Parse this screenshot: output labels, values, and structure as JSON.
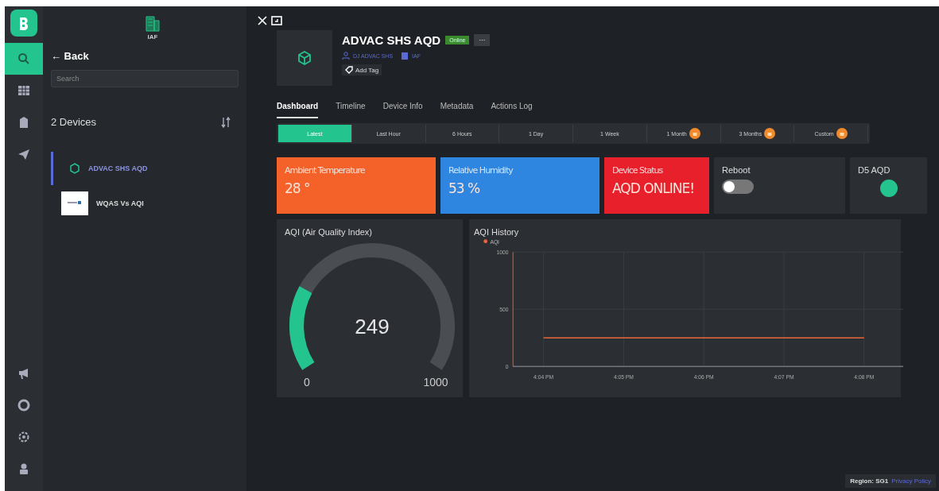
{
  "org": {
    "label": "IAF"
  },
  "nav": {
    "back": "← Back",
    "search": {
      "placeholder": "Search"
    },
    "count": "2 Devices"
  },
  "rail": [
    {
      "kind": "search",
      "selected": true
    },
    {
      "kind": "grid",
      "selected": false
    },
    {
      "kind": "building",
      "selected": false
    },
    {
      "kind": "send",
      "selected": false
    }
  ],
  "rail_bottom": [
    {
      "kind": "megaphone"
    },
    {
      "kind": "help"
    },
    {
      "kind": "settings"
    },
    {
      "kind": "user"
    }
  ],
  "devices": [
    {
      "name": "ADVAC SHS AQD",
      "selected": true,
      "kind": "cube"
    },
    {
      "name": "WQAS Vs AQI",
      "selected": false,
      "kind": "thumbnail"
    }
  ],
  "device": {
    "title": "ADVAC SHS AQD",
    "status": "Online",
    "more": "···",
    "owner": "DJ ADVAC SHS",
    "org": "IAF",
    "add_tag": "Add Tag"
  },
  "tabs": [
    {
      "label": "Dashboard",
      "selected": true
    },
    {
      "label": "Timeline",
      "selected": false
    },
    {
      "label": "Device Info",
      "selected": false
    },
    {
      "label": "Metadata",
      "selected": false
    },
    {
      "label": "Actions Log",
      "selected": false
    }
  ],
  "ranges": [
    {
      "label": "Latest",
      "selected": true,
      "locked": false
    },
    {
      "label": "Last Hour",
      "selected": false,
      "locked": false
    },
    {
      "label": "6 Hours",
      "selected": false,
      "locked": false
    },
    {
      "label": "1 Day",
      "selected": false,
      "locked": false
    },
    {
      "label": "1 Week",
      "selected": false,
      "locked": false
    },
    {
      "label": "1 Month",
      "selected": false,
      "locked": true
    },
    {
      "label": "3 Months",
      "selected": false,
      "locked": true
    },
    {
      "label": "Custom",
      "selected": false,
      "locked": true
    }
  ],
  "widgets": [
    {
      "kind": "value",
      "title": "Ambient Temperature",
      "value": "28 °",
      "color": "#f4622a"
    },
    {
      "kind": "value",
      "title": "Relative Humidity",
      "value": "53 %",
      "color": "#2f86e0"
    },
    {
      "kind": "value",
      "title": "Device Status",
      "value": "AQD ONLINE!",
      "color": "#e8202c"
    },
    {
      "kind": "switch",
      "title": "Reboot",
      "on": false
    },
    {
      "kind": "led",
      "title": "D5 AQD",
      "color": "#23c48e"
    }
  ],
  "gauge": {
    "title": "AQI (Air Quality Index)",
    "value": "249",
    "min": "0",
    "max": "1000"
  },
  "history": {
    "title": "AQI History",
    "chart_data": {
      "type": "line",
      "categories": [
        "4:04 PM",
        "4:05 PM",
        "4:06 PM",
        "4:07 PM",
        "4:08 PM"
      ],
      "series": [
        {
          "name": "AQI",
          "color": "#e8663a",
          "values": [
            249,
            249,
            249,
            249,
            249
          ]
        }
      ],
      "ylim": [
        0,
        1000
      ],
      "grid": true,
      "yticks": [
        0,
        500,
        1000
      ]
    }
  },
  "footer": {
    "region": "Region: SG1",
    "privacy": "Privacy Policy"
  }
}
